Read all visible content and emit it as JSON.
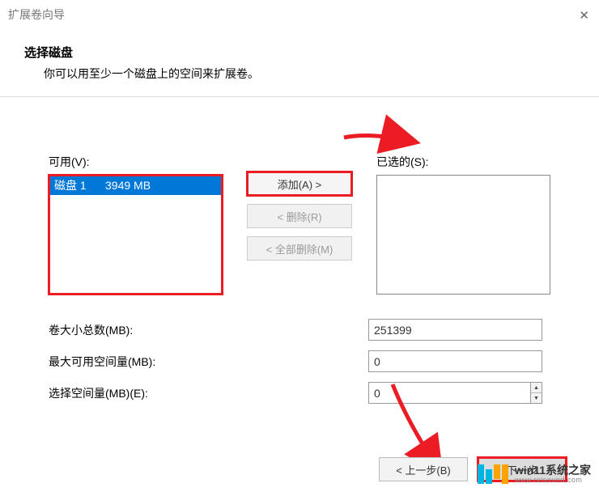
{
  "window": {
    "title": "扩展卷向导"
  },
  "header": {
    "title": "选择磁盘",
    "subtitle": "你可以用至少一个磁盘上的空间来扩展卷。"
  },
  "labels": {
    "available": "可用(V):",
    "selected": "已选的(S):",
    "add": "添加(A) >",
    "remove": "< 删除(R)",
    "remove_all": "< 全部删除(M)",
    "total_mb": "卷大小总数(MB):",
    "max_mb": "最大可用空间量(MB):",
    "select_mb": "选择空间量(MB)(E):",
    "back": "< 上一步(B)",
    "next": "下一步"
  },
  "available_disks": [
    {
      "label": "磁盘 1      3949 MB",
      "selected": true
    }
  ],
  "selected_disks": [],
  "values": {
    "total_mb": "251399",
    "max_mb": "0",
    "select_mb": "0"
  },
  "watermark": {
    "name": "win11系统之家",
    "url": "www.relsound.com"
  }
}
